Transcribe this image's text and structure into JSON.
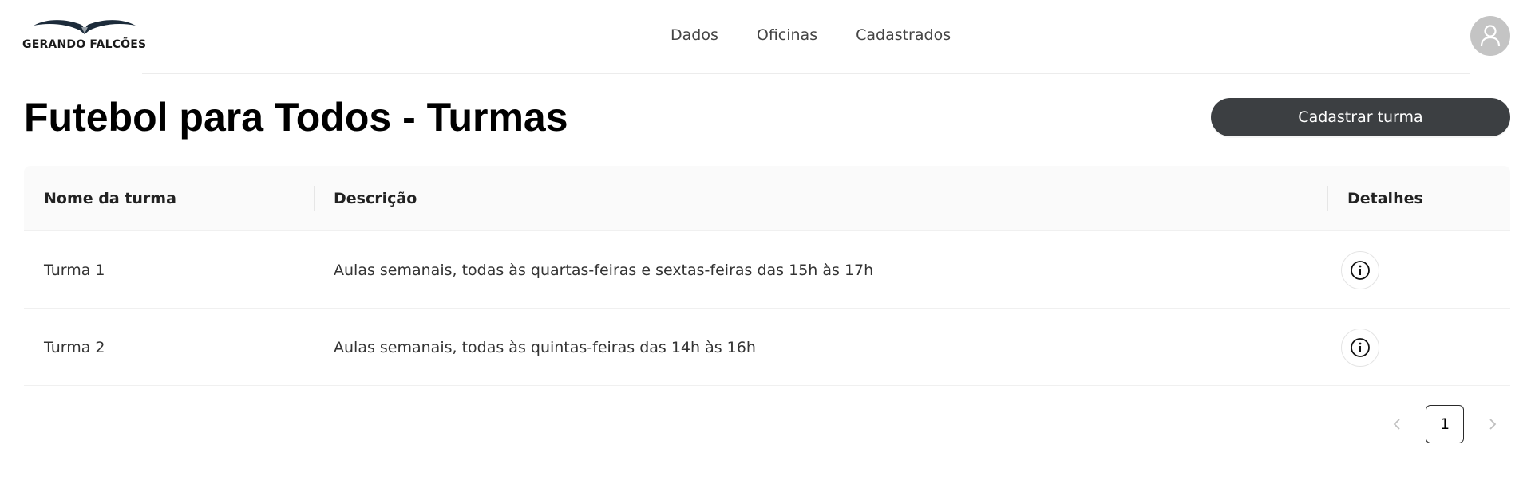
{
  "brand": {
    "name": "GERANDO FALCÕES",
    "logo_icon": "falcon-wings-icon"
  },
  "nav": {
    "items": [
      "Dados",
      "Oficinas",
      "Cadastrados"
    ]
  },
  "user": {
    "avatar_icon": "user-icon"
  },
  "page": {
    "title": "Futebol para Todos - Turmas",
    "primary_action": "Cadastrar turma"
  },
  "table": {
    "columns": [
      "Nome da turma",
      "Descrição",
      "Detalhes"
    ],
    "rows": [
      {
        "name": "Turma 1",
        "description": "Aulas semanais, todas às quartas-feiras e sextas-feiras das 15h às 17h",
        "details_icon": "info-icon"
      },
      {
        "name": "Turma 2",
        "description": "Aulas semanais, todas às quintas-feiras das 14h às 16h",
        "details_icon": "info-icon"
      }
    ]
  },
  "pagination": {
    "current_page": "1",
    "prev_icon": "chevron-left-icon",
    "next_icon": "chevron-right-icon"
  }
}
